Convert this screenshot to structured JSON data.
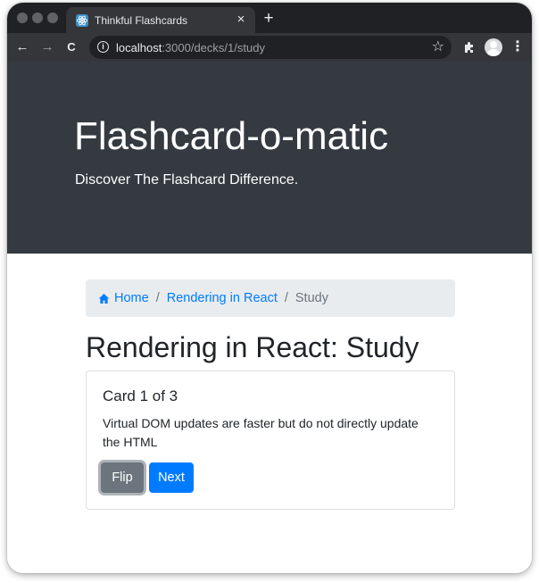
{
  "browser": {
    "tab_title": "Thinkful Flashcards",
    "tab_close_glyph": "×",
    "new_tab_glyph": "+",
    "back_glyph": "←",
    "forward_glyph": "→",
    "reload_glyph": "C",
    "url_host": "localhost",
    "url_path": ":3000/decks/1/study",
    "info_glyph": "i",
    "star_glyph": "☆",
    "menu_glyph": "⋮",
    "icons": [
      "react-favicon-icon",
      "info-icon",
      "star-icon",
      "puzzle-extension-icon",
      "profile-avatar-icon",
      "kebab-menu-icon"
    ]
  },
  "header": {
    "title": "Flashcard-o-matic",
    "subtitle": "Discover The Flashcard Difference."
  },
  "breadcrumb": {
    "home_label": "Home",
    "deck_label": "Rendering in React",
    "current_label": "Study",
    "separator": "/"
  },
  "page": {
    "title": "Rendering in React: Study"
  },
  "card": {
    "title": "Card 1 of 3",
    "text": "Virtual DOM updates are faster but do not directly update the HTML",
    "flip_label": "Flip",
    "next_label": "Next"
  },
  "colors": {
    "jumbotron_bg": "#343a40",
    "link": "#007bff",
    "flip_button": "#6c757d",
    "next_button": "#007bff",
    "breadcrumb_bg": "#e9ecef"
  }
}
